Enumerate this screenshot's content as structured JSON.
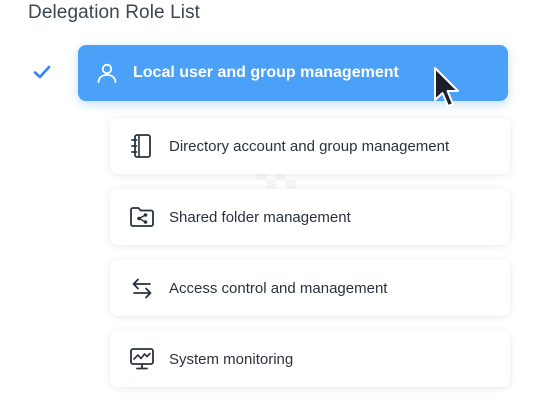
{
  "header": {
    "title": "Delegation Role List"
  },
  "roles": [
    {
      "label": "Local user and group management",
      "icon": "user-icon",
      "selected": true
    },
    {
      "label": "Directory account and group management",
      "icon": "address-book-icon",
      "selected": false
    },
    {
      "label": "Shared folder management",
      "icon": "shared-folder-icon",
      "selected": false
    },
    {
      "label": "Access control and management",
      "icon": "arrows-exchange-icon",
      "selected": false
    },
    {
      "label": "System monitoring",
      "icon": "monitor-chart-icon",
      "selected": false
    }
  ],
  "colors": {
    "accent": "#4ba1f7",
    "check": "#2f86f0",
    "text": "#2a323d",
    "title": "#3c4653"
  }
}
